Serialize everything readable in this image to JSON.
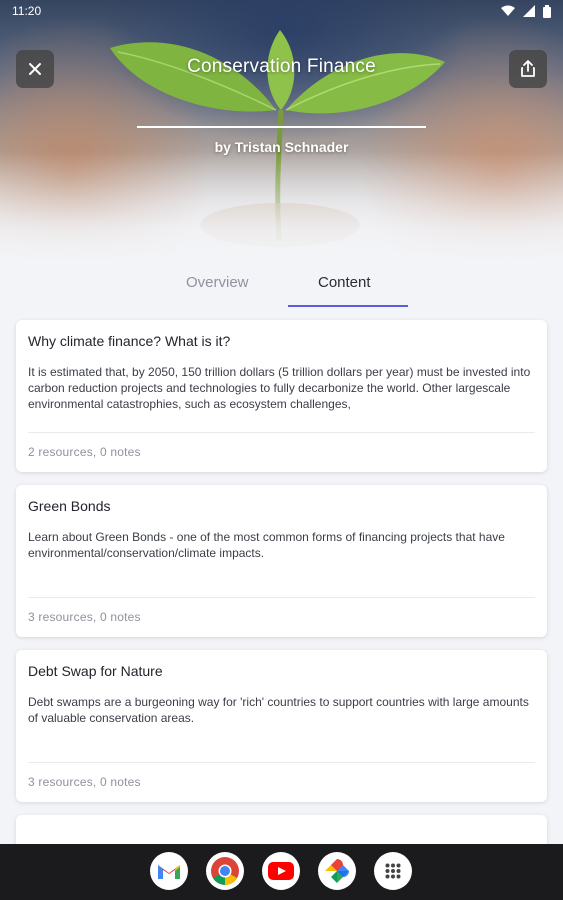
{
  "status_bar": {
    "time": "11:20"
  },
  "header": {
    "title": "Conservation Finance",
    "author": "by Tristan Schnader",
    "close_icon": "close-icon",
    "share_icon": "share-icon"
  },
  "tabs": [
    {
      "label": "Overview",
      "selected": false
    },
    {
      "label": "Content",
      "selected": true
    }
  ],
  "colors": {
    "accent": "#5b5ce0",
    "nav_background": "#1b1b1d"
  },
  "modules": [
    {
      "title": "Why climate finance? What is it?",
      "description": "It is estimated that, by 2050, 150 trillion dollars (5 trillion dollars per year) must be invested into carbon reduction projects and technologies to fully decarbonize the world. Other largescale environmental catastrophies, such as ecosystem challenges,",
      "meta": "2 resources, 0 notes"
    },
    {
      "title": "Green Bonds",
      "description": "Learn about Green Bonds - one of the most common forms of financing projects that have environmental/conservation/climate impacts.",
      "meta": "3 resources, 0 notes"
    },
    {
      "title": "Debt Swap for Nature",
      "description": "Debt swamps are a burgeoning way for 'rich' countries to support countries with large amounts of valuable conservation areas.",
      "meta": "3 resources, 0 notes"
    }
  ],
  "dock_apps": [
    {
      "name": "Gmail",
      "icon": "gmail-icon"
    },
    {
      "name": "Chrome",
      "icon": "chrome-icon"
    },
    {
      "name": "YouTube",
      "icon": "youtube-icon"
    },
    {
      "name": "Photos",
      "icon": "photos-icon"
    },
    {
      "name": "App drawer",
      "icon": "apps-grid-icon"
    }
  ]
}
